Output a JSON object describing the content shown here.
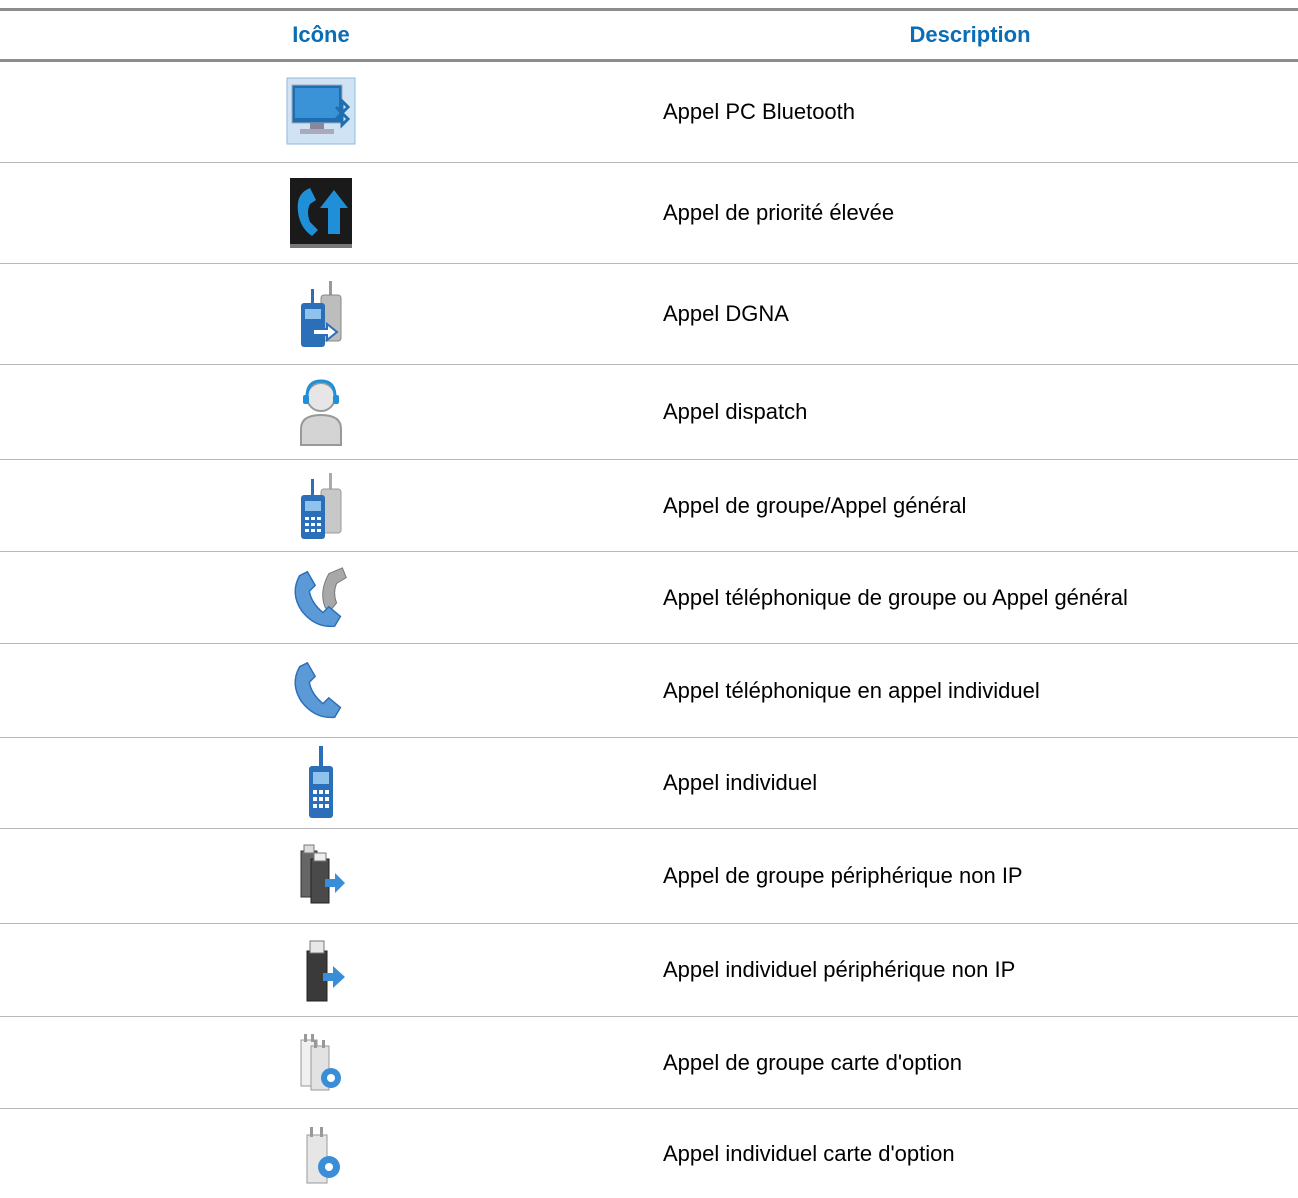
{
  "table": {
    "header": {
      "icon_col": "Icône",
      "desc_col": "Description"
    },
    "rows": [
      {
        "icon": "bluetooth-pc-icon",
        "description": "Appel PC Bluetooth"
      },
      {
        "icon": "high-priority-call-icon",
        "description": "Appel de priorité élevée"
      },
      {
        "icon": "dgna-call-icon",
        "description": "Appel DGNA"
      },
      {
        "icon": "dispatch-call-icon",
        "description": "Appel dispatch"
      },
      {
        "icon": "group-call-icon",
        "description": "Appel de groupe/Appel général"
      },
      {
        "icon": "group-phone-call-icon",
        "description": "Appel téléphonique de groupe ou Appel général"
      },
      {
        "icon": "private-phone-call-icon",
        "description": "Appel téléphonique en appel individuel"
      },
      {
        "icon": "private-call-icon",
        "description": "Appel individuel"
      },
      {
        "icon": "non-ip-peripheral-group-call-icon",
        "description": "Appel de groupe périphérique non IP"
      },
      {
        "icon": "non-ip-peripheral-private-call-icon",
        "description": "Appel individuel périphérique non IP"
      },
      {
        "icon": "option-board-group-call-icon",
        "description": "Appel de groupe carte d'option"
      },
      {
        "icon": "option-board-private-call-icon",
        "description": "Appel individuel carte d'option"
      }
    ]
  },
  "colors": {
    "header_text": "#0a6db6",
    "rule": "#8c8c8c",
    "divider": "#b8b8b8"
  }
}
